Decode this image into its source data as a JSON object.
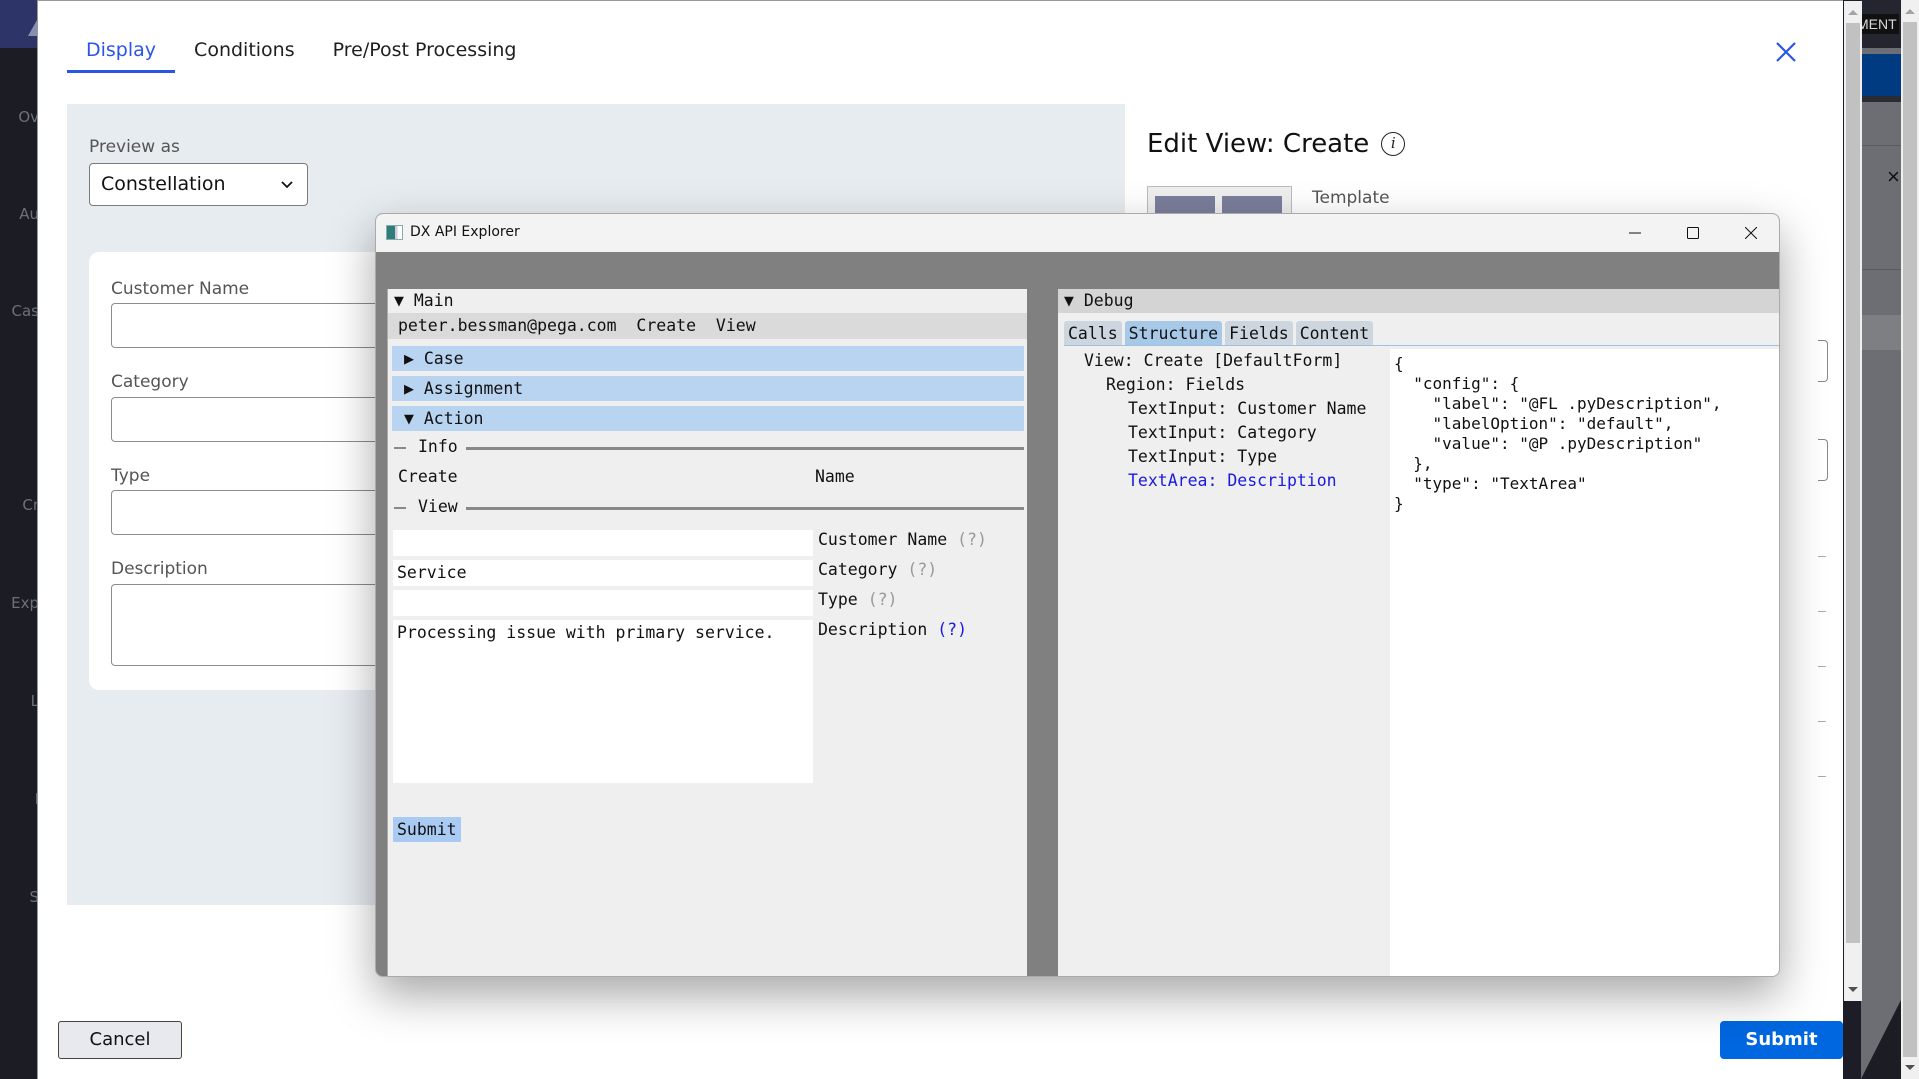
{
  "background_app": {
    "nav_items": [
      "Ov",
      "Au",
      "Cas",
      "Cr",
      "Exp",
      "L",
      "I",
      "S"
    ],
    "header_text": "MENT",
    "close_glyph": "×"
  },
  "modal": {
    "tabs": [
      {
        "label": "Display",
        "active": true
      },
      {
        "label": "Conditions",
        "active": false
      },
      {
        "label": "Pre/Post Processing",
        "active": false
      }
    ],
    "close_icon": "close-icon",
    "preview": {
      "label": "Preview as",
      "selected": "Constellation",
      "fields": [
        {
          "label": "Customer Name",
          "value": ""
        },
        {
          "label": "Category",
          "value": ""
        },
        {
          "label": "Type",
          "value": ""
        },
        {
          "label": "Description",
          "value": ""
        }
      ]
    },
    "edit_view": {
      "title": "Edit View: Create",
      "template_label": "Template"
    },
    "footer": {
      "cancel_label": "Cancel",
      "submit_label": "Submit"
    }
  },
  "dx_explorer": {
    "window_title": "DX API Explorer",
    "main": {
      "header": "▼ Main",
      "user": "peter.bessman@pega.com",
      "breadcrumb_create": "Create",
      "breadcrumb_view": "View",
      "sections": [
        {
          "label": "▶ Case",
          "expanded": false
        },
        {
          "label": "▶ Assignment",
          "expanded": false
        },
        {
          "label": "▼ Action",
          "expanded": true
        }
      ],
      "info_title": "Info",
      "info_left": "Create",
      "info_right": "Name",
      "view_title": "View",
      "fields": [
        {
          "value": "",
          "label": "Customer Name",
          "help": "(?)",
          "help_active": false
        },
        {
          "value": "Service",
          "label": "Category",
          "help": "(?)",
          "help_active": false
        },
        {
          "value": "",
          "label": "Type",
          "help": "(?)",
          "help_active": false
        },
        {
          "value": "Processing issue with primary service.",
          "label": "Description",
          "help": "(?)",
          "help_active": true
        }
      ],
      "submit_label": "Submit"
    },
    "debug": {
      "header": "▼ Debug",
      "tabs": [
        {
          "label": "Calls",
          "active": false
        },
        {
          "label": "Structure",
          "active": true
        },
        {
          "label": "Fields",
          "active": false
        },
        {
          "label": "Content",
          "active": false
        }
      ],
      "tree": [
        {
          "text": "View: Create [DefaultForm]",
          "depth": 1,
          "selected": false
        },
        {
          "text": "Region: Fields",
          "depth": 2,
          "selected": false
        },
        {
          "text": "TextInput: Customer Name",
          "depth": 3,
          "selected": false
        },
        {
          "text": "TextInput: Category",
          "depth": 3,
          "selected": false
        },
        {
          "text": "TextInput: Type",
          "depth": 3,
          "selected": false
        },
        {
          "text": "TextArea: Description",
          "depth": 3,
          "selected": true
        }
      ],
      "json_lines": [
        "{",
        "  \"config\": {",
        "    \"label\": \"@FL .pyDescription\",",
        "    \"labelOption\": \"default\",",
        "    \"value\": \"@P .pyDescription\"",
        "  },",
        "  \"type\": \"TextArea\"",
        "}"
      ]
    }
  },
  "colors": {
    "accent_blue": "#2a55e5",
    "submit_blue": "#0067e0",
    "section_blue": "#b9d4f1",
    "selected_tree": "#1a1ae0"
  }
}
